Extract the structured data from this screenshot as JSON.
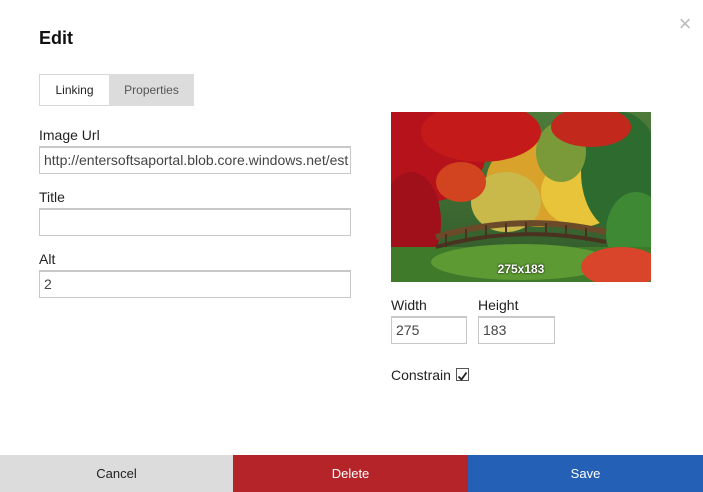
{
  "dialog": {
    "title": "Edit",
    "close_icon": "×"
  },
  "tabs": [
    {
      "label": "Linking",
      "active": true
    },
    {
      "label": "Properties",
      "active": false
    }
  ],
  "fields": {
    "image_url": {
      "label": "Image Url",
      "value": "http://entersoftsaportal.blob.core.windows.net/est"
    },
    "title": {
      "label": "Title",
      "value": ""
    },
    "alt": {
      "label": "Alt",
      "value": "2"
    }
  },
  "preview": {
    "dimensions_label": "275x183"
  },
  "size": {
    "width_label": "Width",
    "width_value": "275",
    "height_label": "Height",
    "height_value": "183",
    "constrain_label": "Constrain",
    "constrain_checked": true
  },
  "footer": {
    "cancel": "Cancel",
    "delete": "Delete",
    "save": "Save"
  },
  "colors": {
    "delete": "#b52428",
    "save": "#2461b6",
    "cancel": "#dcdcdc"
  }
}
